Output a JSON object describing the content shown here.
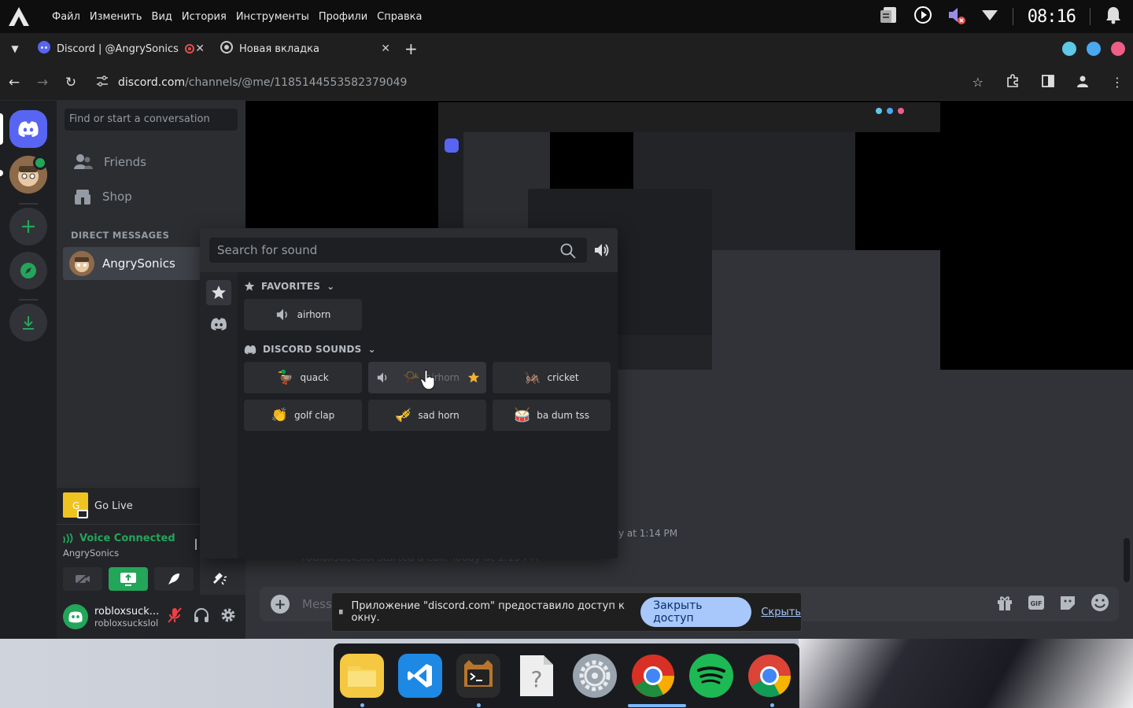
{
  "menubar": {
    "menus": [
      "Файл",
      "Изменить",
      "Вид",
      "История",
      "Инструменты",
      "Профили",
      "Справка"
    ],
    "clock": "08:16"
  },
  "tabs": [
    {
      "title": "Discord | @AngrySonics",
      "icon": "discord-icon"
    },
    {
      "title": "Новая вкладка",
      "icon": "chrome-icon"
    }
  ],
  "window_dots": [
    "#5ec8e6",
    "#4aa8f0",
    "#ef5d88"
  ],
  "address": {
    "host": "discord.com",
    "path": "/channels/@me/1185144553582379049"
  },
  "dm_sidebar": {
    "search_placeholder": "Find or start a conversation",
    "friends": "Friends",
    "shop": "Shop",
    "dm_header": "DIRECT MESSAGES",
    "dm_user": "AngrySonics"
  },
  "golive": "Go Live",
  "voice": {
    "status": "Voice Connected",
    "channel": "AngrySonics"
  },
  "user": {
    "name": "robloxsuck...",
    "tag": "robloxsuckslol"
  },
  "soundboard": {
    "search_placeholder": "Search for sound",
    "favorites_label": "FAVORITES",
    "discord_sounds_label": "DISCORD SOUNDS",
    "favorites": [
      {
        "name": "airhorn",
        "icon": "speaker-icon"
      }
    ],
    "sounds": [
      {
        "name": "quack",
        "emoji": "🦆"
      },
      {
        "name": "airhorn",
        "emoji": "📯",
        "highlight": true
      },
      {
        "name": "cricket",
        "emoji": "🦗"
      },
      {
        "name": "golf clap",
        "emoji": "👏"
      },
      {
        "name": "sad horn",
        "emoji": "🎺"
      },
      {
        "name": "ba dum tss",
        "emoji": "🥁"
      }
    ]
  },
  "chat": {
    "timestamp": "y at 1:14 PM",
    "system_msg": "robloxsuckslol started a call. Today at 1:15 PM",
    "placeholder": "Mess"
  },
  "share_bar": {
    "message": "Приложение \"discord.com\" предоставило доступ к окну.",
    "stop": "Закрыть доступ",
    "hide": "Скрыть"
  },
  "dock_apps": [
    "files",
    "vscode",
    "terminal",
    "unknown-file",
    "settings",
    "chromium",
    "spotify",
    "chrome"
  ]
}
